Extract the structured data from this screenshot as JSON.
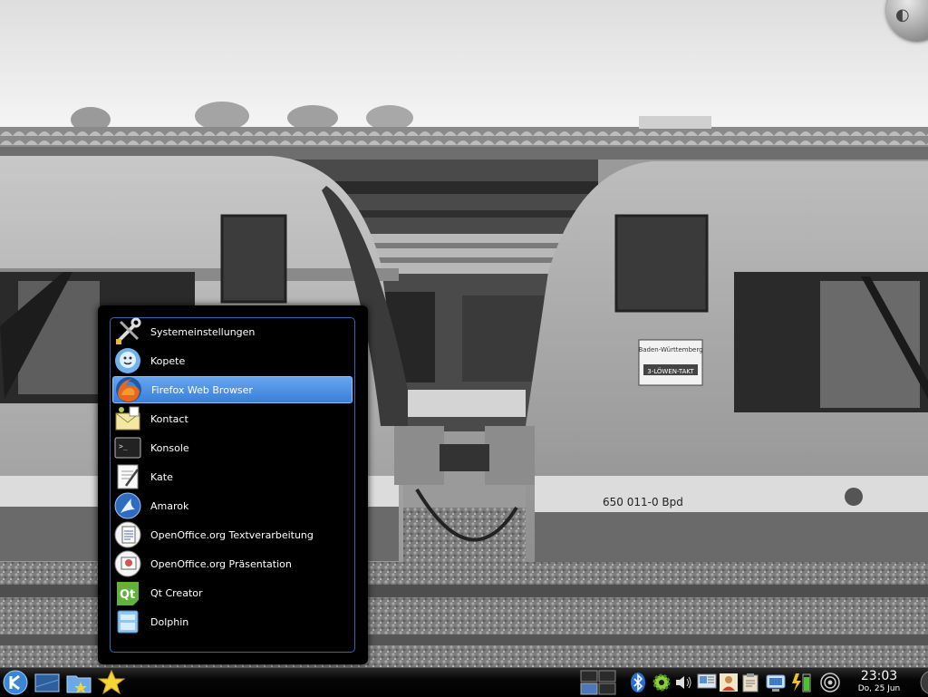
{
  "menu": {
    "items": [
      {
        "label": "Systemeinstellungen",
        "icon": "system-settings-icon"
      },
      {
        "label": "Kopete",
        "icon": "kopete-icon"
      },
      {
        "label": "Firefox Web Browser",
        "icon": "firefox-icon",
        "active": true
      },
      {
        "label": "Kontact",
        "icon": "kontact-icon"
      },
      {
        "label": "Konsole",
        "icon": "konsole-icon"
      },
      {
        "label": "Kate",
        "icon": "kate-icon"
      },
      {
        "label": "Amarok",
        "icon": "amarok-icon"
      },
      {
        "label": "OpenOffice.org Textverarbeitung",
        "icon": "writer-icon"
      },
      {
        "label": "OpenOffice.org Präsentation",
        "icon": "impress-icon"
      },
      {
        "label": "Qt Creator",
        "icon": "qt-creator-icon"
      },
      {
        "label": "Dolphin",
        "icon": "dolphin-icon"
      }
    ],
    "highlight_color": "#4a90e8"
  },
  "panel": {
    "launchers": [
      "kde-menu-icon",
      "show-desktop-icon",
      "folder-icon",
      "favorites-star-icon"
    ],
    "tray_icons": [
      "pager-icon",
      "bluetooth-icon",
      "settings-gear-icon",
      "volume-icon",
      "display-icon",
      "user-icon",
      "clipboard-icon",
      "network-monitor-icon",
      "battery-power-icon",
      "wireless-icon"
    ],
    "clock": {
      "time": "23:03",
      "date": "Do, 25 Jun"
    }
  },
  "wallpaper": {
    "train_left_label": "",
    "train_right_number": "650 011-0  Bpd",
    "sticker_line1": "Baden-Württemberg",
    "sticker_line2": "3-LÖWEN-TAKT"
  },
  "colors": {
    "accent": "#3b64b4",
    "panel": "#000000"
  }
}
